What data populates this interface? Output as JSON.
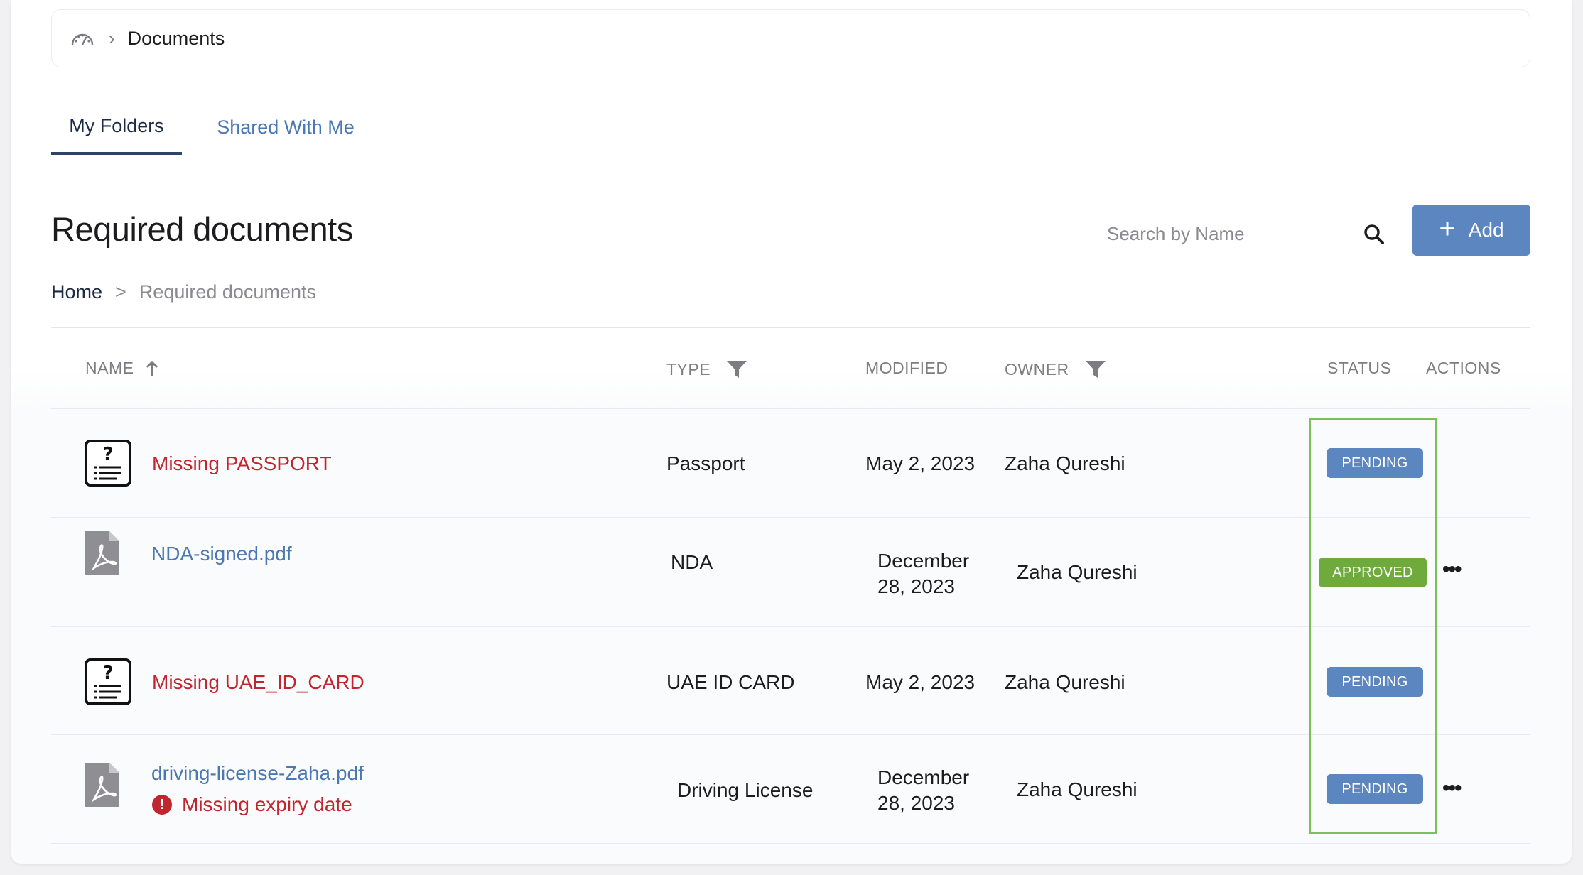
{
  "top_breadcrumb": {
    "label": "Documents"
  },
  "tabs": [
    {
      "label": "My Folders",
      "active": true
    },
    {
      "label": "Shared With Me",
      "active": false
    }
  ],
  "page_title": "Required documents",
  "search": {
    "placeholder": "Search by Name"
  },
  "add_button": {
    "label": "Add"
  },
  "breadcrumb": {
    "home": "Home",
    "separator": ">",
    "current": "Required documents"
  },
  "columns": {
    "name": "NAME",
    "type": "TYPE",
    "modified": "MODIFIED",
    "owner": "OWNER",
    "status": "STATUS",
    "actions": "ACTIONS"
  },
  "rows": [
    {
      "name": "Missing PASSPORT",
      "kind": "missing",
      "type": "Passport",
      "modified": "May 2, 2023",
      "owner": "Zaha Qureshi",
      "status": "PENDING",
      "has_actions": false
    },
    {
      "name": "NDA-signed.pdf",
      "kind": "file",
      "type": "NDA",
      "modified_line1": "December",
      "modified_line2": "28, 2023",
      "owner": "Zaha Qureshi",
      "status": "APPROVED",
      "has_actions": true
    },
    {
      "name": "Missing UAE_ID_CARD",
      "kind": "missing",
      "type": "UAE ID CARD",
      "modified": "May 2, 2023",
      "owner": "Zaha Qureshi",
      "status": "PENDING",
      "has_actions": false
    },
    {
      "name": "driving-license-Zaha.pdf",
      "kind": "file",
      "warning": "Missing expiry date",
      "type": "Driving License",
      "modified_line1": "December",
      "modified_line2": "28, 2023",
      "owner": "Zaha Qureshi",
      "status": "PENDING",
      "has_actions": true
    }
  ],
  "colors": {
    "accent": "#5b86bf",
    "approved": "#6eab3c",
    "error": "#c0262d",
    "link": "#4a78b3",
    "highlight": "#7dc05b"
  }
}
